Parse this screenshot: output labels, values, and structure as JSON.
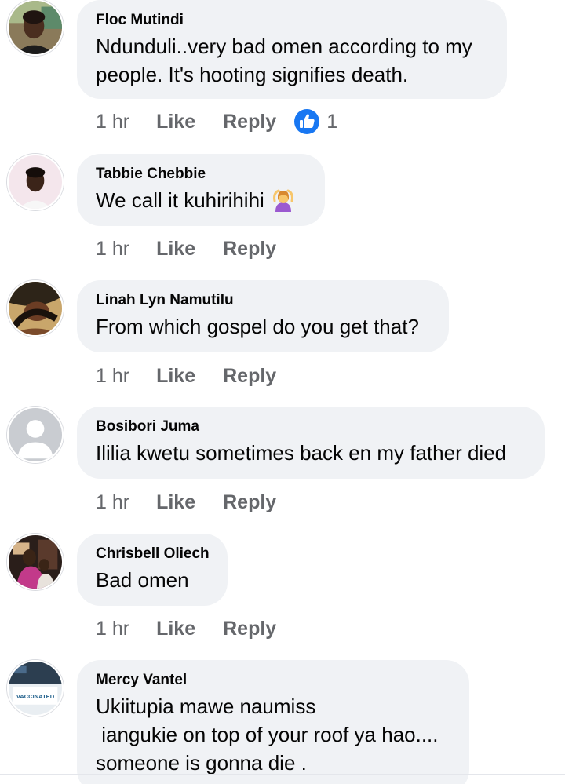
{
  "comments": [
    {
      "author": "Floc Mutindi",
      "lines": [
        "Ndunduli..very bad omen according to my",
        "people. It's hooting signifies death."
      ],
      "time": "1 hr",
      "like": "Like",
      "reply": "Reply",
      "reaction_count": "1"
    },
    {
      "author": "Tabbie Chebbie",
      "lines": [
        "We call it kuhirihihi"
      ],
      "time": "1 hr",
      "like": "Like",
      "reply": "Reply"
    },
    {
      "author": "Linah Lyn Namutilu",
      "lines": [
        "From which gospel do you get that?"
      ],
      "time": "1 hr",
      "like": "Like",
      "reply": "Reply"
    },
    {
      "author": "Bosibori Juma",
      "lines": [
        "Ililia kwetu sometimes back en my father died"
      ],
      "time": "1 hr",
      "like": "Like",
      "reply": "Reply"
    },
    {
      "author": "Chrisbell Oliech",
      "lines": [
        "Bad omen"
      ],
      "time": "1 hr",
      "like": "Like",
      "reply": "Reply"
    },
    {
      "author": "Mercy Vantel",
      "lines": [
        "Ukiitupia mawe naumiss",
        " iangukie on top of your roof ya hao....",
        "someone is gonna die ."
      ],
      "avatar_badge": "VACCINATED"
    }
  ],
  "colors": {
    "bubble": "#f0f2f5",
    "meta_text": "#65676b",
    "like_reaction": "#1877f2"
  },
  "icons": {
    "reaction": "thumbs-up-icon",
    "emoji": "person-gesturing-ok-emoji"
  }
}
